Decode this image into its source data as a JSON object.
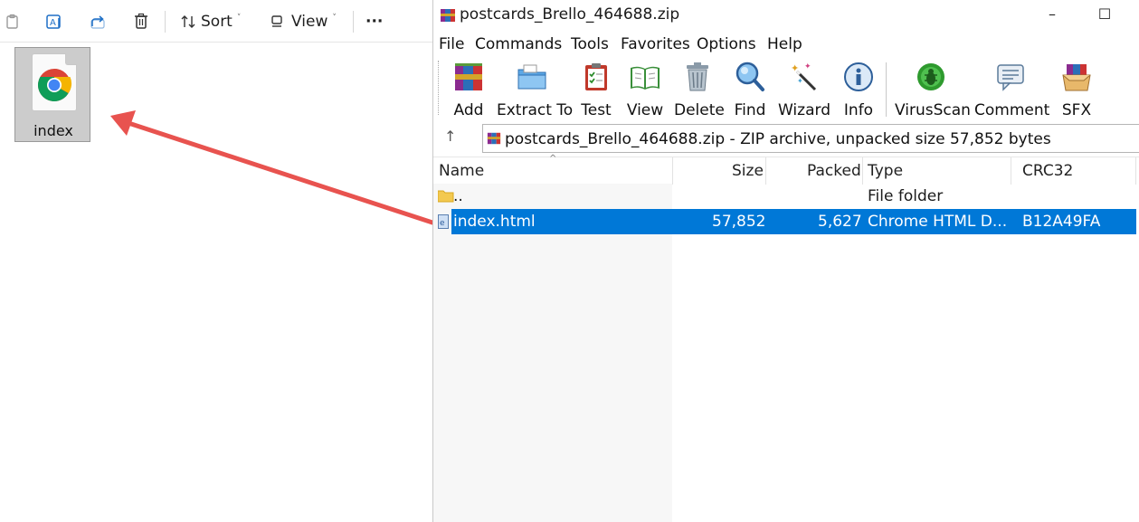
{
  "explorer": {
    "toolbar": {
      "sort_label": "Sort",
      "view_label": "View",
      "more_label": "···"
    },
    "file": {
      "name": "index"
    }
  },
  "winrar": {
    "title": "postcards_Brello_464688.zip",
    "window_buttons": {
      "minimize": "–",
      "maximize": "☐"
    },
    "menu": [
      "File",
      "Commands",
      "Tools",
      "Favorites",
      "Options",
      "Help"
    ],
    "toolbar": [
      "Add",
      "Extract To",
      "Test",
      "View",
      "Delete",
      "Find",
      "Wizard",
      "Info",
      "VirusScan",
      "Comment",
      "SFX"
    ],
    "address": "postcards_Brello_464688.zip - ZIP archive, unpacked size 57,852 bytes",
    "columns": [
      "Name",
      "Size",
      "Packed",
      "Type",
      "CRC32"
    ],
    "rows": [
      {
        "name": "..",
        "size": "",
        "packed": "",
        "type": "File folder",
        "crc": ""
      },
      {
        "name": "index.html",
        "size": "57,852",
        "packed": "5,627",
        "type": "Chrome HTML D...",
        "crc": "B12A49FA"
      }
    ],
    "colors": {
      "selection": "#0078d7",
      "arrow": "#e8534f"
    }
  }
}
